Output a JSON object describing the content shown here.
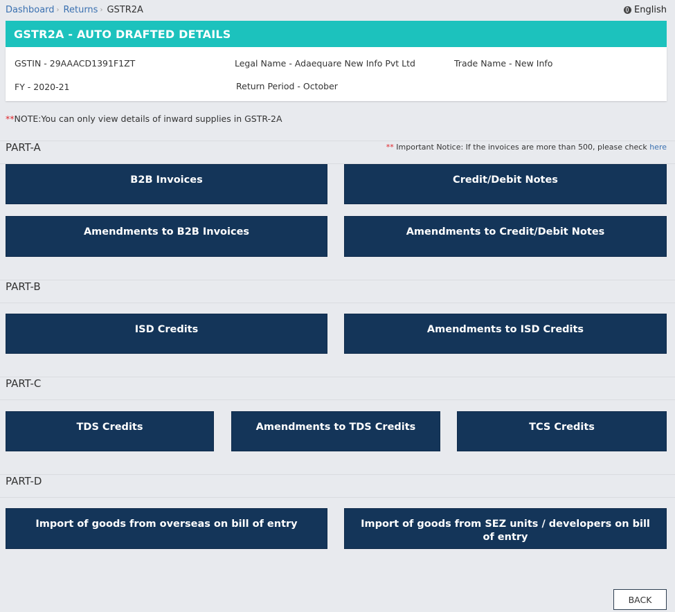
{
  "breadcrumb": {
    "dashboard": "Dashboard",
    "returns": "Returns",
    "current": "GSTR2A",
    "separator": "›"
  },
  "language": "English",
  "header": {
    "title": "GSTR2A - AUTO DRAFTED DETAILS"
  },
  "details": {
    "gstin": "GSTIN - 29AAACD1391F1ZT",
    "legal_name": "Legal Name - Adaequare New Info Pvt Ltd",
    "trade_name": "Trade Name - New Info",
    "fy": "FY - 2020-21",
    "return_period": "Return Period - October"
  },
  "note": {
    "stars": "**",
    "text": "NOTE:You can only view details of inward supplies in GSTR-2A"
  },
  "notice": {
    "stars": "**",
    "text": " Important Notice: If the invoices are more than 500, please check ",
    "link": "here"
  },
  "parts": {
    "a": {
      "title": "PART-A",
      "tiles": [
        "B2B Invoices",
        "Credit/Debit Notes",
        "Amendments to B2B Invoices",
        "Amendments to Credit/Debit Notes"
      ]
    },
    "b": {
      "title": "PART-B",
      "tiles": [
        "ISD Credits",
        "Amendments to ISD Credits"
      ]
    },
    "c": {
      "title": "PART-C",
      "tiles": [
        "TDS Credits",
        "Amendments to TDS Credits",
        "TCS Credits"
      ]
    },
    "d": {
      "title": "PART-D",
      "tiles": [
        "Import of goods from overseas on bill of entry",
        "Import of goods from SEZ units / developers on bill of entry"
      ]
    }
  },
  "back_label": "BACK",
  "colors": {
    "teal": "#1cc2bd",
    "navy": "#143559",
    "link": "#3a70b0",
    "red": "#e0262b",
    "background": "#e8eaee"
  }
}
